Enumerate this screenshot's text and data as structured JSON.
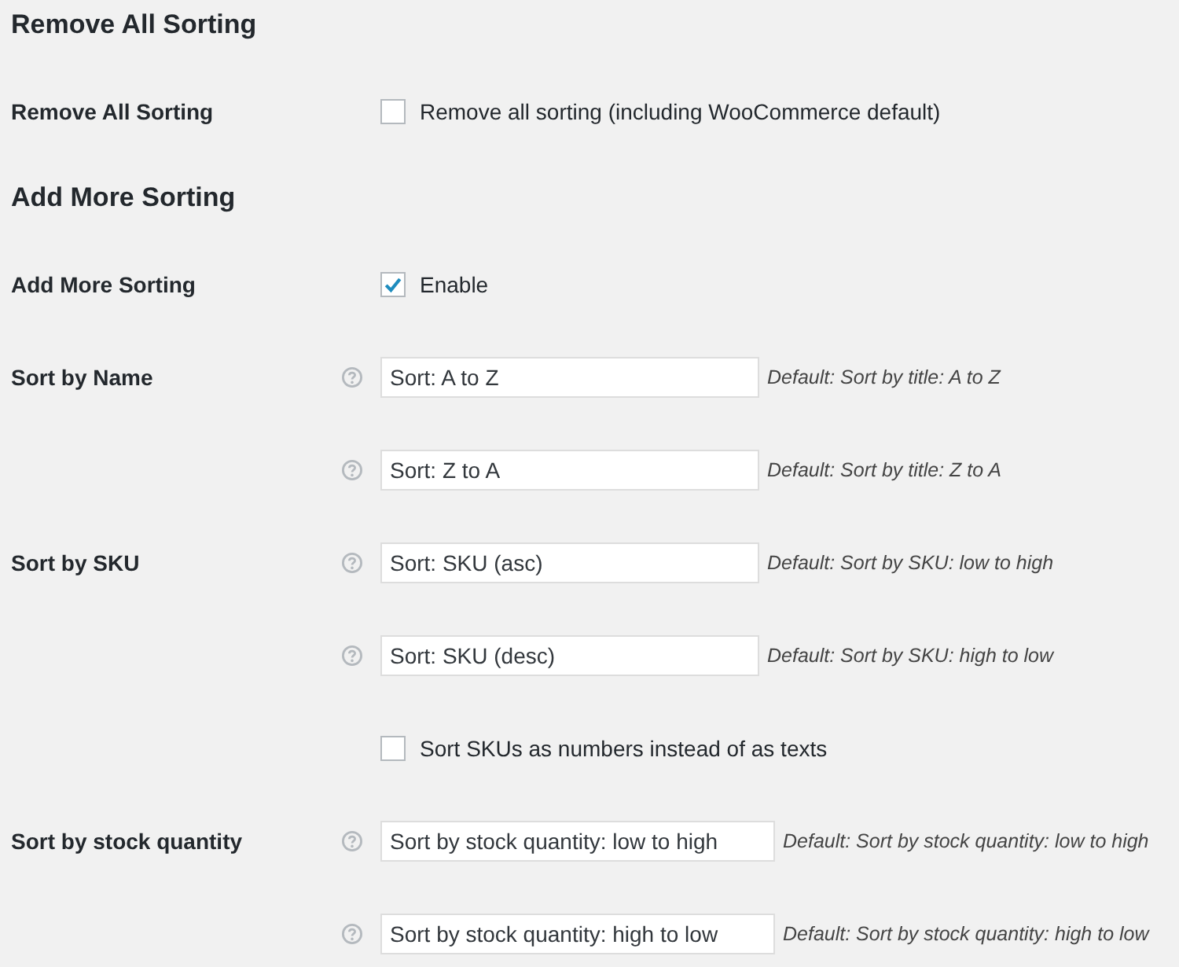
{
  "sections": [
    {
      "title": "Remove All Sorting",
      "rows": [
        {
          "label": "Remove All Sorting",
          "help": false,
          "kind": "checkbox",
          "checked": false,
          "text": "Remove all sorting (including WooCommerce default)"
        }
      ]
    },
    {
      "title": "Add More Sorting",
      "rows": [
        {
          "label": "Add More Sorting",
          "help": false,
          "kind": "checkbox",
          "checked": true,
          "text": "Enable"
        },
        {
          "label": "Sort by Name",
          "help": true,
          "kind": "text",
          "value": "Sort: A to Z",
          "description": "Default: Sort by title: A to Z"
        },
        {
          "help": true,
          "kind": "text",
          "value": "Sort: Z to A",
          "description": "Default: Sort by title: Z to A"
        },
        {
          "label": "Sort by SKU",
          "help": true,
          "kind": "text",
          "value": "Sort: SKU (asc)",
          "description": "Default: Sort by SKU: low to high"
        },
        {
          "help": true,
          "kind": "text",
          "value": "Sort: SKU (desc)",
          "description": "Default: Sort by SKU: high to low"
        },
        {
          "help": false,
          "kind": "checkbox",
          "checked": false,
          "text": "Sort SKUs as numbers instead of as texts"
        },
        {
          "label": "Sort by stock quantity",
          "help": true,
          "kind": "text",
          "value": "Sort by stock quantity: low to high",
          "description": "Default: Sort by stock quantity: low to high"
        },
        {
          "help": true,
          "kind": "text",
          "value": "Sort by stock quantity: high to low",
          "description": "Default: Sort by stock quantity: high to low"
        }
      ]
    }
  ]
}
